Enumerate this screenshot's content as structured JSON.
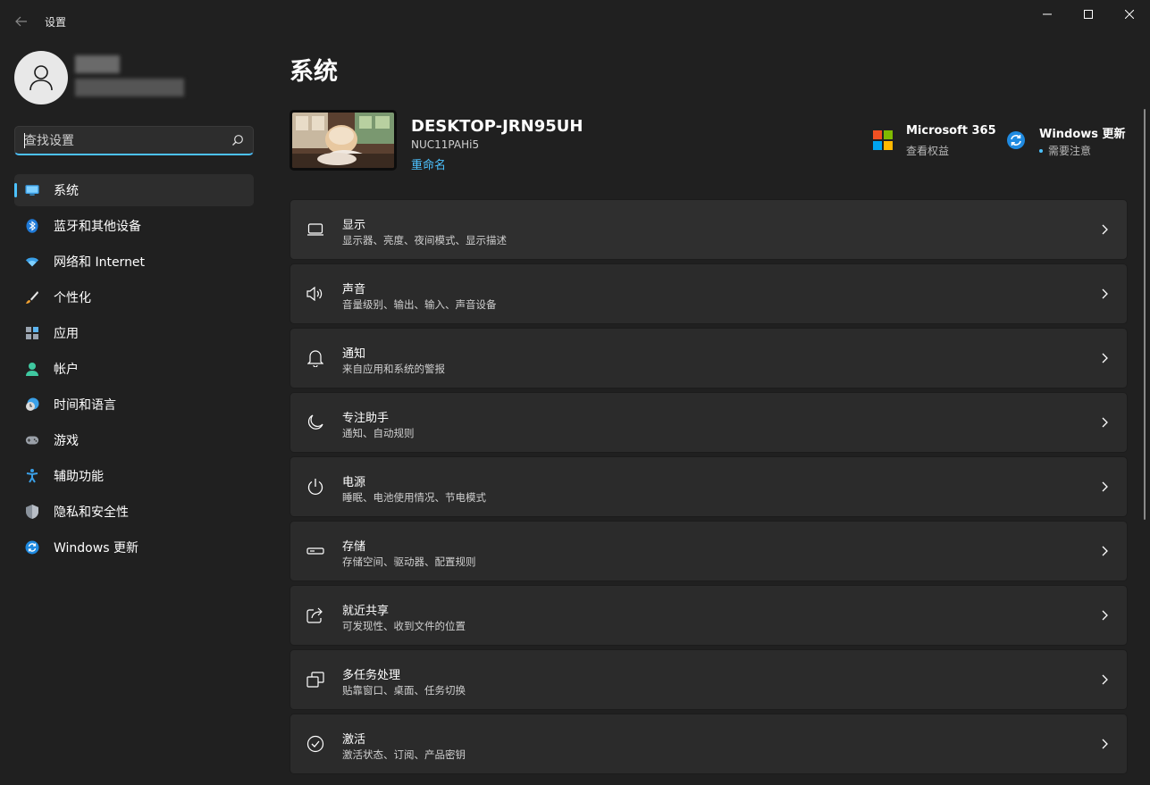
{
  "window": {
    "app_title": "设置",
    "controls": [
      "minimize-icon",
      "maximize-icon",
      "close-icon"
    ]
  },
  "search": {
    "placeholder": "查找设置"
  },
  "sidebar": {
    "items": [
      {
        "label": "系统",
        "icon": "system-display-icon",
        "active": true
      },
      {
        "label": "蓝牙和其他设备",
        "icon": "bluetooth-icon"
      },
      {
        "label": "网络和 Internet",
        "icon": "wifi-icon"
      },
      {
        "label": "个性化",
        "icon": "brush-icon"
      },
      {
        "label": "应用",
        "icon": "apps-icon"
      },
      {
        "label": "帐户",
        "icon": "account-icon"
      },
      {
        "label": "时间和语言",
        "icon": "time-language-icon"
      },
      {
        "label": "游戏",
        "icon": "gamepad-icon"
      },
      {
        "label": "辅助功能",
        "icon": "accessibility-icon"
      },
      {
        "label": "隐私和安全性",
        "icon": "shield-icon"
      },
      {
        "label": "Windows 更新",
        "icon": "windows-update-icon"
      }
    ]
  },
  "main": {
    "title": "系统",
    "device": {
      "name": "DESKTOP-JRN95UH",
      "model": "NUC11PAHi5",
      "rename": "重命名"
    },
    "promos": {
      "microsoft365": {
        "title": "Microsoft 365",
        "subtitle": "查看权益"
      },
      "windows_update": {
        "title": "Windows 更新",
        "subtitle": "需要注意"
      }
    },
    "cards": [
      {
        "title": "显示",
        "subtitle": "显示器、亮度、夜间模式、显示描述",
        "icon": "display-icon"
      },
      {
        "title": "声音",
        "subtitle": "音量级别、输出、输入、声音设备",
        "icon": "speaker-icon"
      },
      {
        "title": "通知",
        "subtitle": "来自应用和系统的警报",
        "icon": "bell-icon"
      },
      {
        "title": "专注助手",
        "subtitle": "通知、自动规则",
        "icon": "moon-icon"
      },
      {
        "title": "电源",
        "subtitle": "睡眠、电池使用情况、节电模式",
        "icon": "power-icon"
      },
      {
        "title": "存储",
        "subtitle": "存储空间、驱动器、配置规则",
        "icon": "storage-icon"
      },
      {
        "title": "就近共享",
        "subtitle": "可发现性、收到文件的位置",
        "icon": "share-icon"
      },
      {
        "title": "多任务处理",
        "subtitle": "贴靠窗口、桌面、任务切换",
        "icon": "multitask-icon"
      },
      {
        "title": "激活",
        "subtitle": "激活状态、订阅、产品密钥",
        "icon": "check-circle-icon"
      }
    ]
  },
  "colors": {
    "accent": "#4cc2ff",
    "background": "#202020",
    "card": "#2b2b2b"
  }
}
